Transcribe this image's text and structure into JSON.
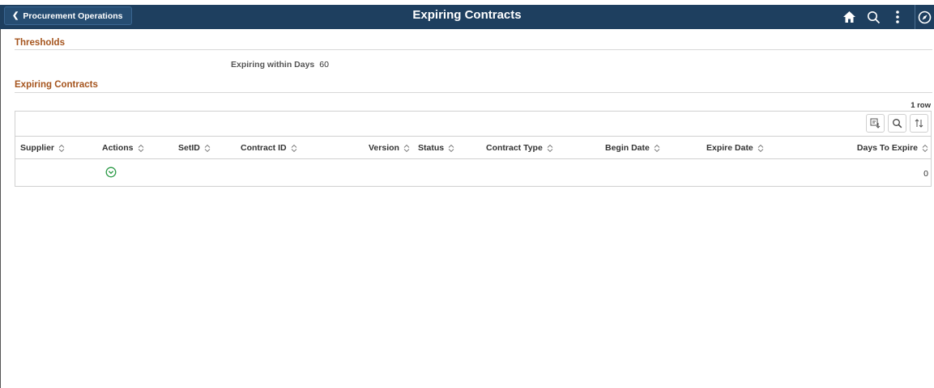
{
  "banner": {
    "back_label": "Procurement Operations",
    "title": "Expiring Contracts",
    "icons": [
      "home-icon",
      "search-icon",
      "more-vertical-icon",
      "navbar-compass-icon"
    ]
  },
  "thresholds": {
    "section_title": "Thresholds",
    "label": "Expiring within Days",
    "value": "60"
  },
  "expiring": {
    "section_title": "Expiring Contracts",
    "row_count": "1 row",
    "toolbar_icons": [
      "download-icon",
      "find-icon",
      "sort-icon"
    ],
    "columns": [
      "Supplier",
      "Actions",
      "SetID",
      "Contract ID",
      "Version",
      "Status",
      "Contract Type",
      "Begin Date",
      "Expire Date",
      "Days To Expire"
    ],
    "rows": [
      {
        "supplier": "",
        "setid": "",
        "contract_id": "",
        "version": "",
        "status": "",
        "contract_type": "",
        "begin_date": "",
        "expire_date": "",
        "days_to_expire": "0"
      }
    ]
  },
  "colors": {
    "banner_bg": "#1e3f5f",
    "section_title": "#a5541d",
    "action_green": "#2e9b49"
  }
}
